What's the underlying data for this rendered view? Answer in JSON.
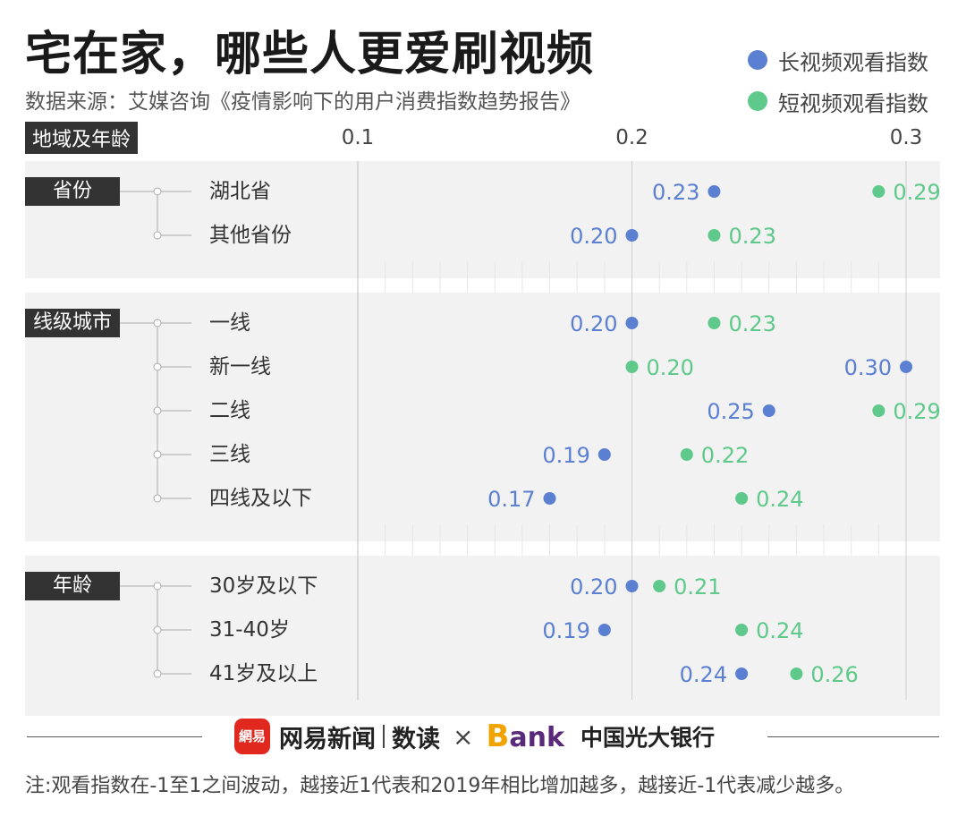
{
  "title": "宅在家，哪些人更爱刷视频",
  "source": "数据来源：艾媒咨询《疫情影响下的用户消费指数趋势报告》",
  "axis_heading": "地域及年龄",
  "colors": {
    "long": "#5b7fd1",
    "short": "#5ec98a",
    "panel": "#f2f2f2",
    "dark": "#333333"
  },
  "chart_data": {
    "type": "scatter",
    "x_ticks": [
      "0.1",
      "0.2",
      "0.3"
    ],
    "xlim": [
      0.1,
      0.3
    ],
    "series": [
      {
        "name": "长视频观看指数",
        "key": "long"
      },
      {
        "name": "短视频观看指数",
        "key": "short"
      }
    ],
    "groups": [
      {
        "label": "省份",
        "rows": [
          {
            "label": "湖北省",
            "long": 0.23,
            "short": 0.29,
            "long_text": "0.23",
            "short_text": "0.29"
          },
          {
            "label": "其他省份",
            "long": 0.2,
            "short": 0.23,
            "long_text": "0.20",
            "short_text": "0.23"
          }
        ]
      },
      {
        "label": "线级城市",
        "rows": [
          {
            "label": "一线",
            "long": 0.2,
            "short": 0.23,
            "long_text": "0.20",
            "short_text": "0.23"
          },
          {
            "label": "新一线",
            "long": 0.3,
            "short": 0.2,
            "long_text": "0.30",
            "short_text": "0.20"
          },
          {
            "label": "二线",
            "long": 0.25,
            "short": 0.29,
            "long_text": "0.25",
            "short_text": "0.29"
          },
          {
            "label": "三线",
            "long": 0.19,
            "short": 0.22,
            "long_text": "0.19",
            "short_text": "0.22"
          },
          {
            "label": "四线及以下",
            "long": 0.17,
            "short": 0.24,
            "long_text": "0.17",
            "short_text": "0.24"
          }
        ]
      },
      {
        "label": "年龄",
        "rows": [
          {
            "label": "30岁及以下",
            "long": 0.2,
            "short": 0.21,
            "long_text": "0.20",
            "short_text": "0.21"
          },
          {
            "label": "31-40岁",
            "long": 0.19,
            "short": 0.24,
            "long_text": "0.19",
            "short_text": "0.24"
          },
          {
            "label": "41岁及以上",
            "long": 0.24,
            "short": 0.26,
            "long_text": "0.24",
            "short_text": "0.26"
          }
        ]
      }
    ]
  },
  "footer": {
    "logo_text": "網易",
    "news": "网易新闻",
    "data": "数读",
    "times": "×",
    "bank_b": "B",
    "bank_rest": "ank",
    "partner": "中国光大银行"
  },
  "note": "注:观看指数在-1至1之间波动，越接近1代表和2019年相比增加越多，越接近-1代表减少越多。"
}
